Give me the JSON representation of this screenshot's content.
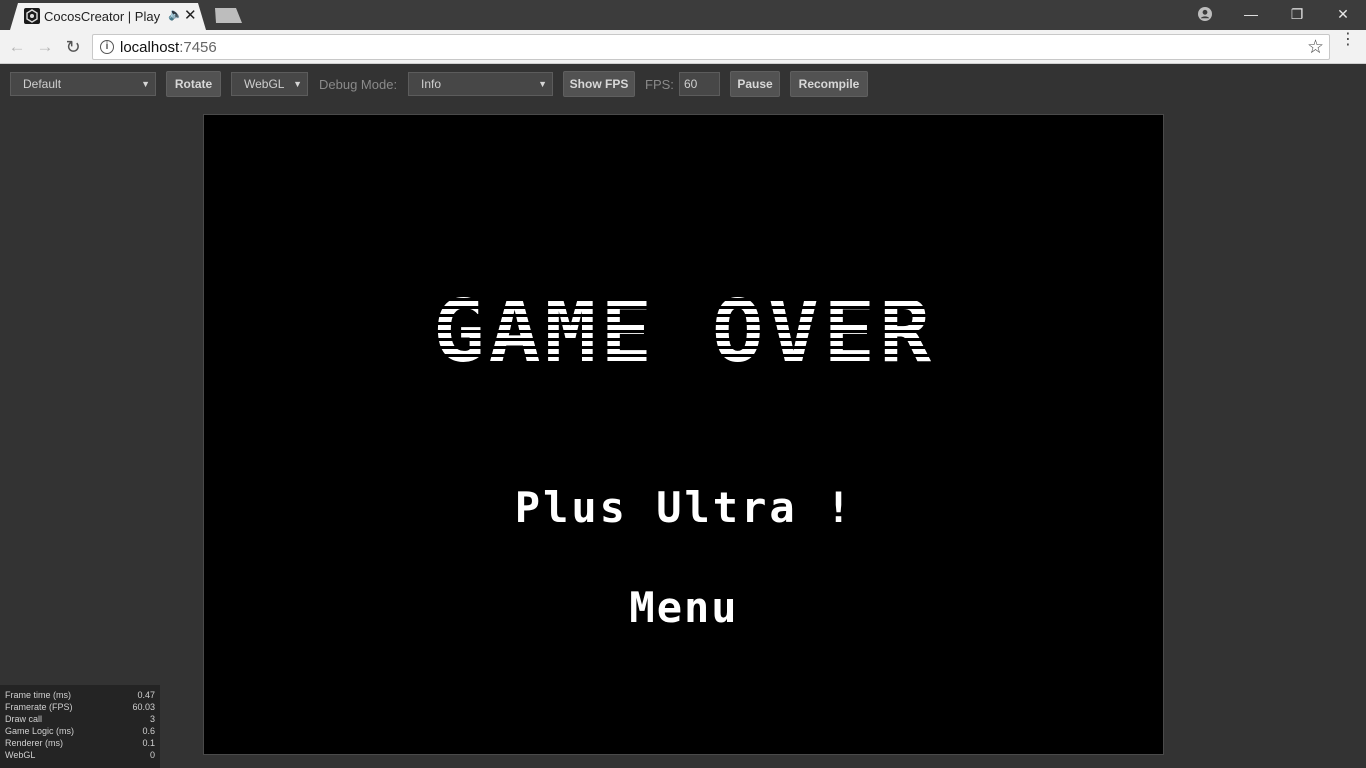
{
  "browser": {
    "tab_title": "CocosCreator | Play",
    "url_host": "localhost",
    "url_port": ":7456"
  },
  "toolbar": {
    "device_select": "Default",
    "rotate_label": "Rotate",
    "renderer_select": "WebGL",
    "debug_mode_label": "Debug Mode:",
    "debug_mode_select": "Info",
    "show_fps_label": "Show FPS",
    "fps_label": "FPS:",
    "fps_value": "60",
    "pause_label": "Pause",
    "recompile_label": "Recompile"
  },
  "game": {
    "title": "GAME OVER",
    "subtitle": "Plus Ultra !",
    "menu_label": "Menu"
  },
  "stats": [
    {
      "label": "Frame time (ms)",
      "value": "0.47"
    },
    {
      "label": "Framerate (FPS)",
      "value": "60.03"
    },
    {
      "label": "Draw call",
      "value": "3"
    },
    {
      "label": "Game Logic (ms)",
      "value": "0.6"
    },
    {
      "label": "Renderer (ms)",
      "value": "0.1"
    },
    {
      "label": "WebGL",
      "value": "0"
    }
  ],
  "colors": {
    "chrome_dark": "#3c3c3c",
    "editor_bg": "#333333",
    "canvas_bg": "#000000",
    "game_text": "#ffffff"
  }
}
